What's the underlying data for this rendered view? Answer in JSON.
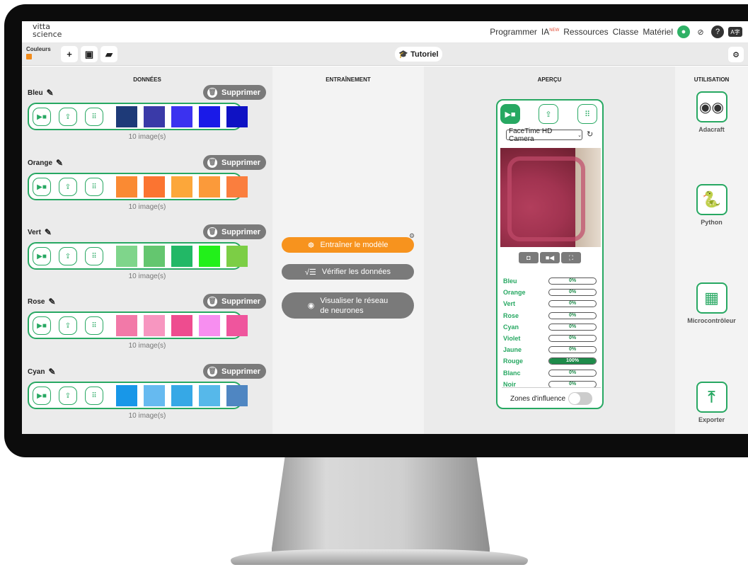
{
  "nav": {
    "logo_line1": "vitta",
    "logo_line2": "science",
    "links": [
      "Programmer",
      "IA",
      "Ressources",
      "Classe",
      "Matériel"
    ],
    "new_badge": "NEW",
    "kbd_label": "A字"
  },
  "toolbar": {
    "project_name": "Couleurs",
    "tutorial_label": "Tutoriel"
  },
  "columns": {
    "data_title": "DONNÉES",
    "train_title": "ENTRAÎNEMENT",
    "preview_title": "APERÇU",
    "use_title": "UTILISATION"
  },
  "delete_label": "Supprimer",
  "classes": [
    {
      "name": "Bleu",
      "count": "10 image(s)",
      "swatches": [
        "#1e3a78",
        "#3a3aa8",
        "#3b32f0",
        "#1a1ae8",
        "#0f12c4"
      ]
    },
    {
      "name": "Orange",
      "count": "10 image(s)",
      "swatches": [
        "#fa8a33",
        "#fb7431",
        "#fca73a",
        "#fb9a3a",
        "#fa7e3e"
      ]
    },
    {
      "name": "Vert",
      "count": "10 image(s)",
      "swatches": [
        "#7fd58b",
        "#64c66f",
        "#22b866",
        "#22f01a",
        "#7cce45"
      ]
    },
    {
      "name": "Rose",
      "count": "10 image(s)",
      "swatches": [
        "#f279a8",
        "#f796c0",
        "#ee4c8f",
        "#f78ef0",
        "#ef559d"
      ]
    },
    {
      "name": "Cyan",
      "count": "10 image(s)",
      "swatches": [
        "#1897e8",
        "#66baf0",
        "#36a8e6",
        "#56b8ea",
        "#4f86c2"
      ]
    }
  ],
  "training": {
    "train_label": "Entraîner le modèle",
    "check_label": "Vérifier les données",
    "visualize_label_1": "Visualiser le réseau",
    "visualize_label_2": "de neurones"
  },
  "preview": {
    "camera_option": "FaceTime HD Camera",
    "results": [
      {
        "label": "Bleu",
        "value": "0%",
        "fraction": 0
      },
      {
        "label": "Orange",
        "value": "0%",
        "fraction": 0
      },
      {
        "label": "Vert",
        "value": "0%",
        "fraction": 0
      },
      {
        "label": "Rose",
        "value": "0%",
        "fraction": 0
      },
      {
        "label": "Cyan",
        "value": "0%",
        "fraction": 0
      },
      {
        "label": "Violet",
        "value": "0%",
        "fraction": 0
      },
      {
        "label": "Jaune",
        "value": "0%",
        "fraction": 0
      },
      {
        "label": "Rouge",
        "value": "100%",
        "fraction": 1
      },
      {
        "label": "Blanc",
        "value": "0%",
        "fraction": 0
      },
      {
        "label": "Noir",
        "value": "0%",
        "fraction": 0
      }
    ],
    "zones_label": "Zones d'influence"
  },
  "use": {
    "items": [
      "Adacraft",
      "Python",
      "Microcontrôleur",
      "Exporter"
    ]
  },
  "colors": {
    "accent_green": "#27a862",
    "orange": "#f7931e",
    "grey_button": "#7a7a7a"
  }
}
